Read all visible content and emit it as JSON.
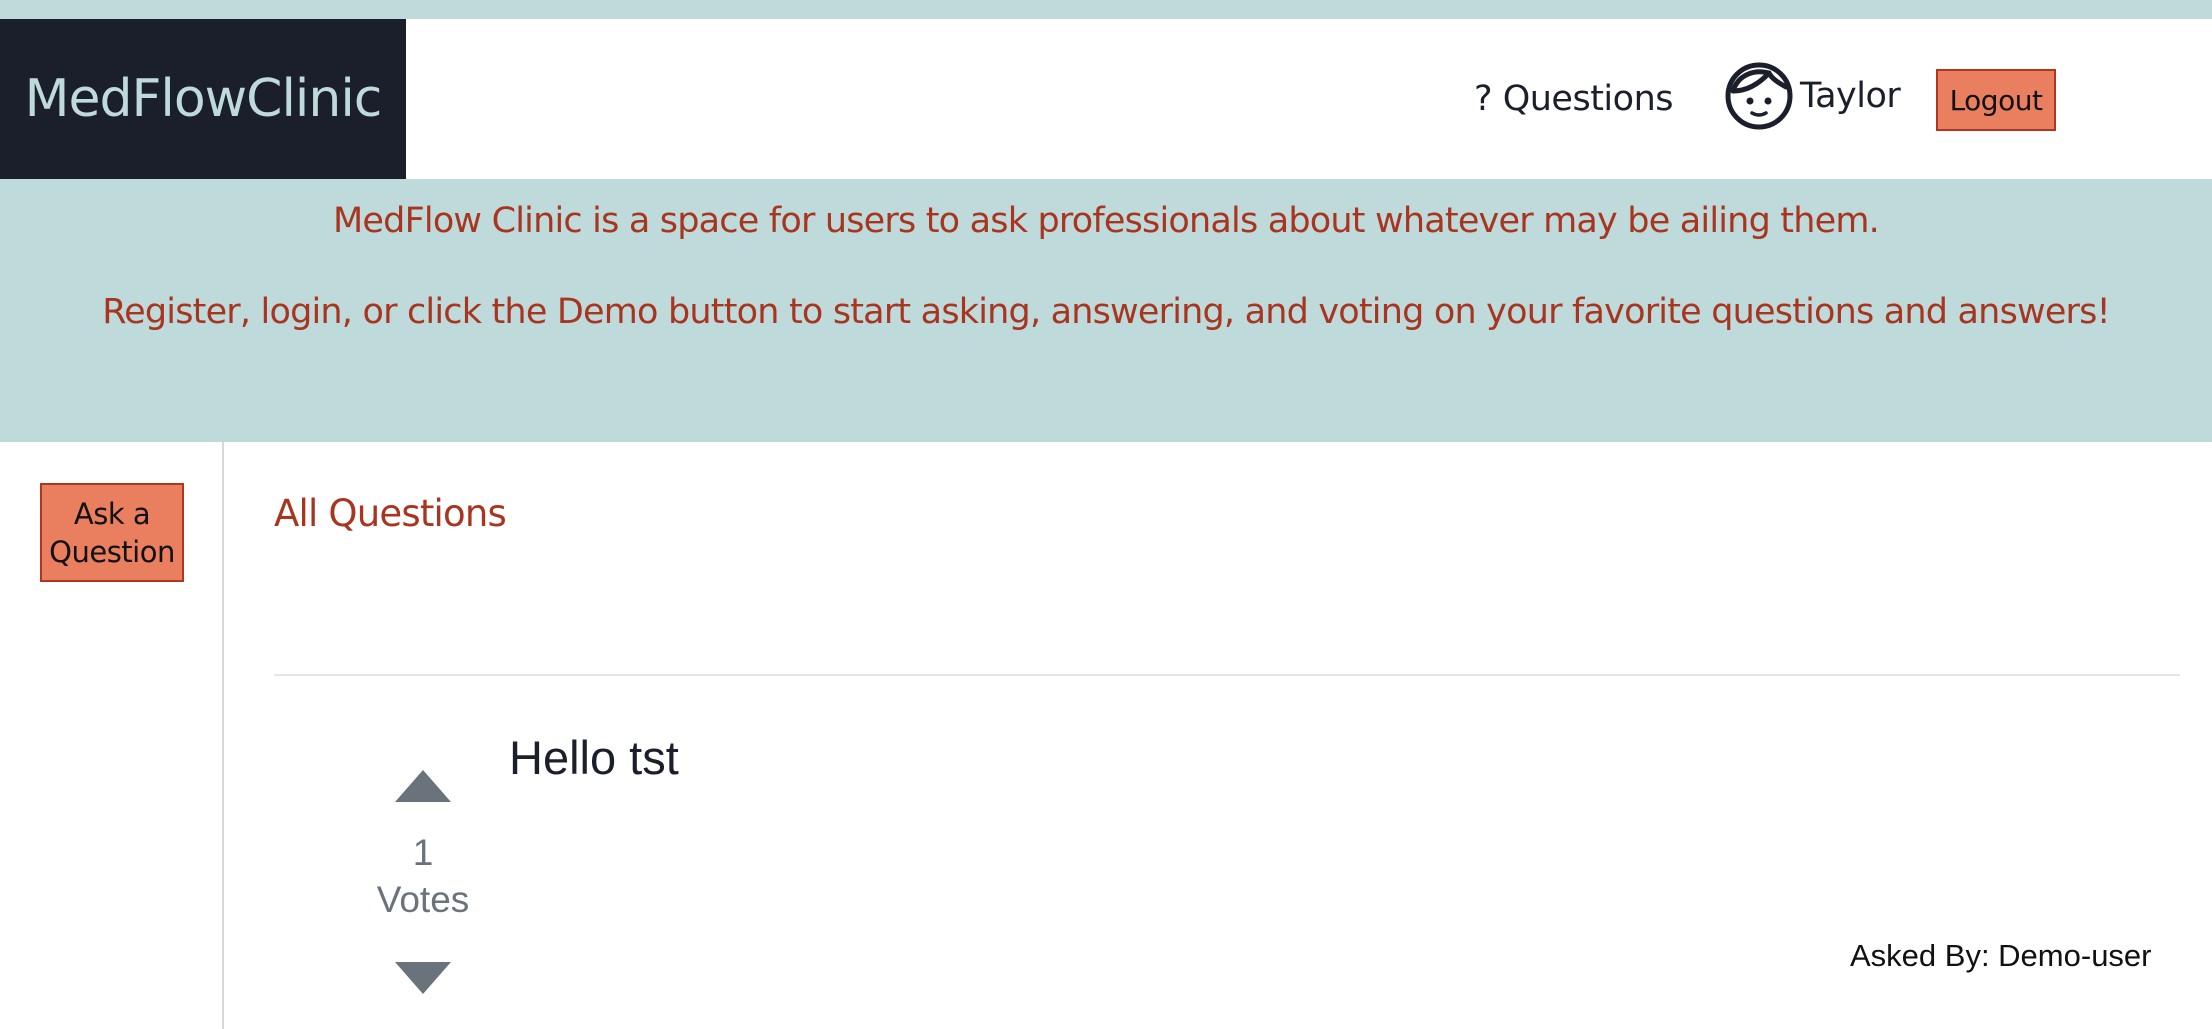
{
  "header": {
    "brand": "MedFlowClinic",
    "nav_questions": "? Questions",
    "user_name": "Taylor",
    "logout_label": "Logout"
  },
  "banner": {
    "line1": "MedFlow Clinic is a space for users to ask professionals about whatever may be ailing them.",
    "line2": "Register, login, or click the Demo button to start asking, answering, and voting on your favorite questions and answers!"
  },
  "sidebar": {
    "ask_line1": "Ask a",
    "ask_line2": "Question"
  },
  "main": {
    "title": "All Questions",
    "questions": [
      {
        "title": "Hello tst",
        "votes": "1",
        "votes_label": "Votes",
        "asked_by": "Asked By: Demo-user"
      }
    ]
  },
  "icons": {
    "user": "user-face-icon",
    "vote_up": "caret-up-icon",
    "vote_down": "caret-down-icon"
  },
  "colors": {
    "brand_bg": "#1b1f2b",
    "brand_text": "#bfdadb",
    "banner_bg": "#bfdadb",
    "accent_text": "#a8351f",
    "button_bg": "#e97f5e",
    "button_border": "#b0361f",
    "vote_gray": "#6a737c"
  }
}
